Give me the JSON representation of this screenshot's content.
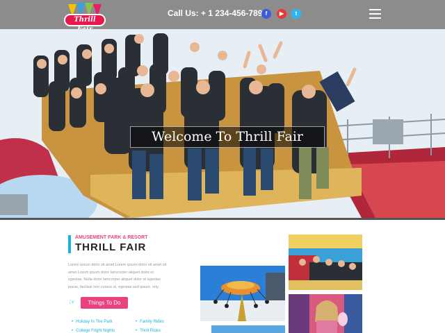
{
  "header": {
    "logo_text": "Thrill Fair",
    "call_label": "Call Us: + 1 234-456-789",
    "social": [
      "f",
      "▶",
      "t"
    ],
    "social_icons": [
      "facebook-icon",
      "youtube-icon",
      "twitter-icon"
    ],
    "menu_icon": "hamburger-menu-icon"
  },
  "hero": {
    "title": "Welcome To Thrill Fair"
  },
  "about": {
    "subtitle": "AMUSEMENT PARK & RESORT",
    "title": "THRILL FAIR",
    "lines": [
      "Lorem ipsum dolor sit amet Lorem ipsum dolor sit amet sit",
      "amet Lorem ipsum dolor lamcorper aliquet dolor et",
      "egestas. Nulla dolor lamcorper aliquet dolor et egestas",
      "purus, facilisis non cursus ut, egestas sed ipsum. srty."
    ],
    "button_label": "Things To Do",
    "features": [
      "Holiday In The Park",
      "Family Rides",
      "College Fright Nights",
      "Thrill Rides"
    ]
  },
  "colors": {
    "header_bg": "#8c8c8c",
    "accent_pink": "#e8437e",
    "accent_cyan": "#1ab3d8"
  }
}
